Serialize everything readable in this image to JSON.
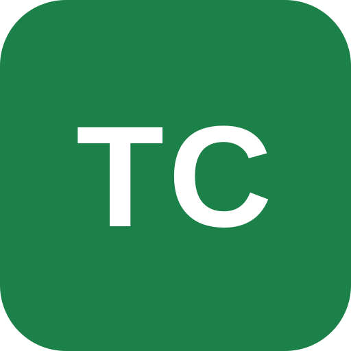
{
  "icon": {
    "monogram": "TC",
    "background_color": "#1b8149",
    "text_color": "#ffffff"
  }
}
